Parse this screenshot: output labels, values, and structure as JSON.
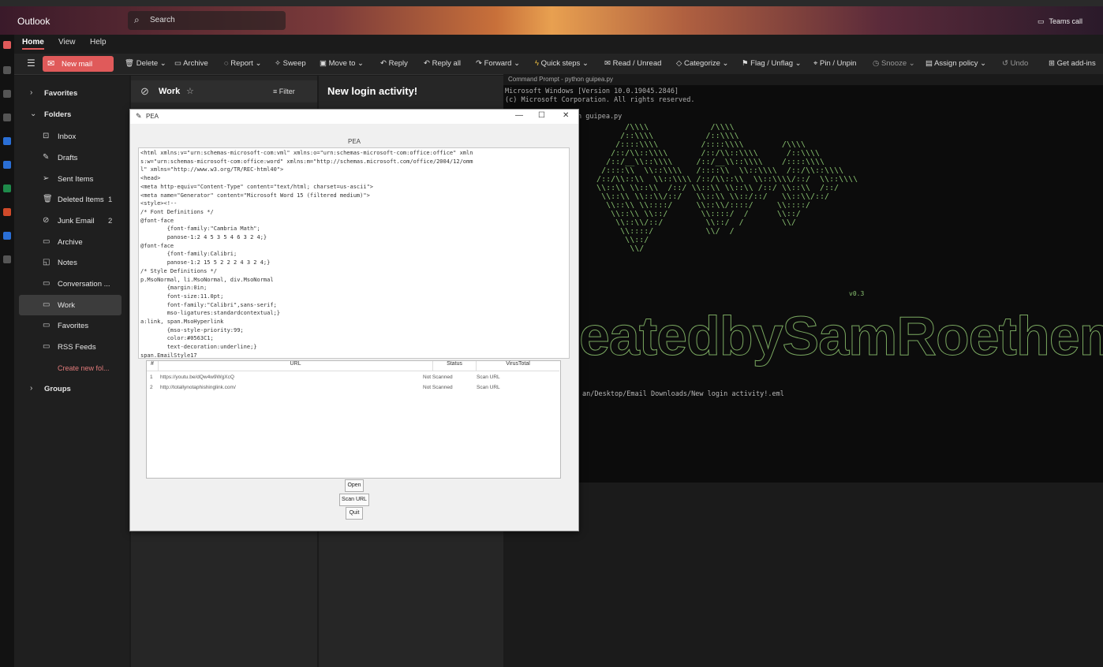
{
  "topbar": {
    "app_name": "Outlook",
    "search_placeholder": "Search",
    "teams_call": "Teams call"
  },
  "tabs": [
    "Home",
    "View",
    "Help"
  ],
  "ribbon": {
    "new_mail": "New mail",
    "delete": "Delete",
    "archive": "Archive",
    "report": "Report",
    "sweep": "Sweep",
    "move_to": "Move to",
    "reply": "Reply",
    "reply_all": "Reply all",
    "forward": "Forward",
    "quick_steps": "Quick steps",
    "read_unread": "Read / Unread",
    "categorize": "Categorize",
    "flag_unflag": "Flag / Unflag",
    "pin_unpin": "Pin / Unpin",
    "snooze": "Snooze",
    "assign_policy": "Assign policy",
    "undo": "Undo",
    "get_addins": "Get add-ins"
  },
  "nav": {
    "favorites": "Favorites",
    "folders": "Folders",
    "inbox": "Inbox",
    "drafts": "Drafts",
    "sent_items": "Sent Items",
    "deleted_items": "Deleted Items",
    "deleted_count": "1",
    "junk_email": "Junk Email",
    "junk_count": "2",
    "archive": "Archive",
    "notes": "Notes",
    "conversation": "Conversation ...",
    "work": "Work",
    "favorites_folder": "Favorites",
    "rss_feeds": "RSS Feeds",
    "create_new_folder": "Create new fol...",
    "groups": "Groups"
  },
  "list": {
    "folder_title": "Work",
    "filter": "Filter"
  },
  "reading": {
    "subject": "New login activity!"
  },
  "cmd": {
    "title": "Command Prompt - python guipea.py",
    "line1": "Microsoft Windows [Version 10.0.19045.2846]",
    "line2": "(c) Microsoft Corporation. All rights reserved.",
    "line3": "n guipea.py",
    "version": "v0.3",
    "banner": "eatedbySamRoethemeyer",
    "path": "an/Desktop/Email Downloads/New login activity!.eml"
  },
  "pea": {
    "window_title": "PEA",
    "heading": "PEA",
    "source_lines": [
      "<html xmlns:v=\"urn:schemas-microsoft-com:vml\" xmlns:o=\"urn:schemas-microsoft-com:office:office\" xmln",
      "s:w=\"urn:schemas-microsoft-com:office:word\" xmlns:m=\"http://schemas.microsoft.com/office/2004/12/omm",
      "l\" xmlns=\"http://www.w3.org/TR/REC-html40\">",
      "<head>",
      "<meta http-equiv=\"Content-Type\" content=\"text/html; charset=us-ascii\">",
      "<meta name=\"Generator\" content=\"Microsoft Word 15 (filtered medium)\">",
      "<style><!--",
      "/* Font Definitions */",
      "@font-face",
      "        {font-family:\"Cambria Math\";",
      "        panose-1:2 4 5 3 5 4 6 3 2 4;}",
      "@font-face",
      "        {font-family:Calibri;",
      "        panose-1:2 15 5 2 2 2 4 3 2 4;}",
      "/* Style Definitions */",
      "p.MsoNormal, li.MsoNormal, div.MsoNormal",
      "        {margin:0in;",
      "        font-size:11.0pt;",
      "        font-family:\"Calibri\",sans-serif;",
      "        mso-ligatures:standardcontextual;}",
      "a:link, span.MsoHyperlink",
      "        {mso-style-priority:99;",
      "        color:#0563C1;",
      "        text-decoration:underline;}",
      "span.EmailStyle17"
    ],
    "table": {
      "headers": [
        "#",
        "URL",
        "Status",
        "VirusTotal"
      ],
      "rows": [
        {
          "num": "1",
          "url": "https://youtu.be/dQw4w9WgXcQ",
          "status": "Not Scanned",
          "vt": "Scan URL"
        },
        {
          "num": "2",
          "url": "http://totallynotaphishinglink.com/",
          "status": "Not Scanned",
          "vt": "Scan URL"
        }
      ]
    },
    "buttons": {
      "open": "Open",
      "scan_url": "Scan URL",
      "quit": "Quit"
    }
  },
  "colors": {
    "accent": "#e05a5a",
    "terminal_green": "#88c070",
    "nav_bg": "#1f1f1f"
  }
}
